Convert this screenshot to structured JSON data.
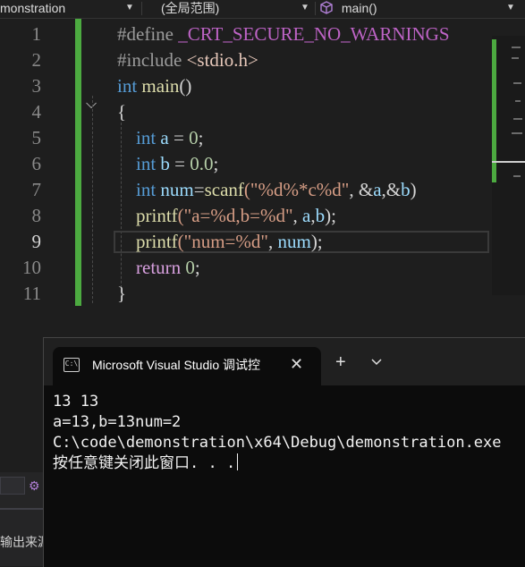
{
  "navbar": {
    "project": "monstration",
    "scope": "(全局范围)",
    "function": "main()",
    "function_icon": "cube-icon"
  },
  "editor": {
    "line_numbers": [
      "1",
      "2",
      "3",
      "4",
      "5",
      "6",
      "7",
      "8",
      "9",
      "10",
      "11"
    ],
    "current_line": "9",
    "lines": [
      [
        {
          "t": "#define ",
          "c": "pp"
        },
        {
          "t": "_CRT_SECURE_NO_WARNINGS",
          "c": "mac"
        }
      ],
      [
        {
          "t": "#include ",
          "c": "pp"
        },
        {
          "t": "<stdio.h>",
          "c": "inc"
        }
      ],
      [
        {
          "t": "int ",
          "c": "kw"
        },
        {
          "t": "main",
          "c": "fn"
        },
        {
          "t": "()",
          "c": ""
        }
      ],
      [
        {
          "t": "{",
          "c": ""
        }
      ],
      [
        {
          "t": "    int ",
          "c": "kw"
        },
        {
          "t": "a",
          "c": "var"
        },
        {
          "t": " = ",
          "c": ""
        },
        {
          "t": "0",
          "c": "num"
        },
        {
          "t": ";",
          "c": ""
        }
      ],
      [
        {
          "t": "    int ",
          "c": "kw"
        },
        {
          "t": "b",
          "c": "var"
        },
        {
          "t": " = ",
          "c": ""
        },
        {
          "t": "0.0",
          "c": "num"
        },
        {
          "t": ";",
          "c": ""
        }
      ],
      [
        {
          "t": "    int ",
          "c": "kw"
        },
        {
          "t": "num",
          "c": "var"
        },
        {
          "t": "=",
          "c": ""
        },
        {
          "t": "scanf",
          "c": "fn"
        },
        {
          "t": "(\"%d%*c%d\"",
          "c": "str"
        },
        {
          "t": ", &",
          "c": ""
        },
        {
          "t": "a",
          "c": "var"
        },
        {
          "t": ",&",
          "c": ""
        },
        {
          "t": "b",
          "c": "var"
        },
        {
          "t": ")",
          "c": ""
        }
      ],
      [
        {
          "t": "    printf",
          "c": "fn"
        },
        {
          "t": "(\"a=%d,b=%d\"",
          "c": "str"
        },
        {
          "t": ", ",
          "c": ""
        },
        {
          "t": "a",
          "c": "var"
        },
        {
          "t": ",",
          "c": ""
        },
        {
          "t": "b",
          "c": "var"
        },
        {
          "t": ");",
          "c": ""
        }
      ],
      [
        {
          "t": "    printf",
          "c": "fn"
        },
        {
          "t": "(\"num=%d\"",
          "c": "str"
        },
        {
          "t": ", ",
          "c": ""
        },
        {
          "t": "num",
          "c": "var"
        },
        {
          "t": ");",
          "c": ""
        }
      ],
      [
        {
          "t": "    return ",
          "c": "ctl"
        },
        {
          "t": "0",
          "c": "num"
        },
        {
          "t": ";",
          "c": ""
        }
      ],
      [
        {
          "t": "}",
          "c": ""
        }
      ]
    ]
  },
  "bottom_left": {
    "label": "输出来源"
  },
  "terminal": {
    "tab_title": "Microsoft Visual Studio 调试控",
    "tab_icon": "console-icon",
    "tab_icon_glyph": "C:\\",
    "close_glyph": "✕",
    "new_tab_glyph": "+",
    "dropdown_glyph": "⌄",
    "output": [
      "13 13",
      "a=13,b=13num=2",
      "C:\\code\\demonstration\\x64\\Debug\\demonstration.exe",
      "按任意键关闭此窗口. . ."
    ]
  }
}
